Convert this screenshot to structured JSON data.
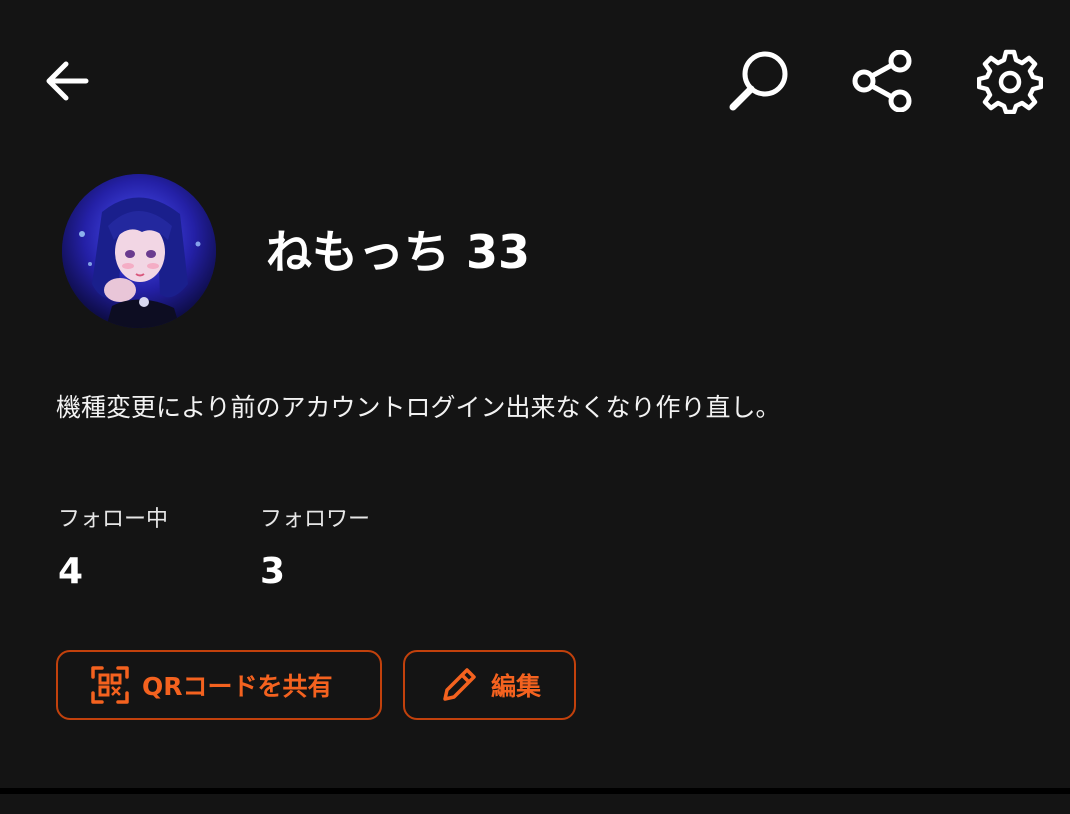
{
  "header": {
    "back_icon": "arrow-left-icon",
    "search_icon": "search-icon",
    "share_icon": "share-icon",
    "settings_icon": "gear-icon"
  },
  "profile": {
    "avatar": "user-avatar",
    "username": "ねもっち 33",
    "bio": "機種変更により前のアカウントログイン出来なくなり作り直し。"
  },
  "stats": [
    {
      "label": "フォロー中",
      "value": "4"
    },
    {
      "label": "フォロワー",
      "value": "3"
    }
  ],
  "actions": {
    "qr_share_label": "QRコードを共有",
    "qr_icon": "qr-code-icon",
    "edit_label": "編集",
    "edit_icon": "pencil-icon"
  },
  "colors": {
    "background": "#141414",
    "accent": "#f4621f",
    "accent_border": "#c2410c",
    "text": "#ffffff"
  }
}
